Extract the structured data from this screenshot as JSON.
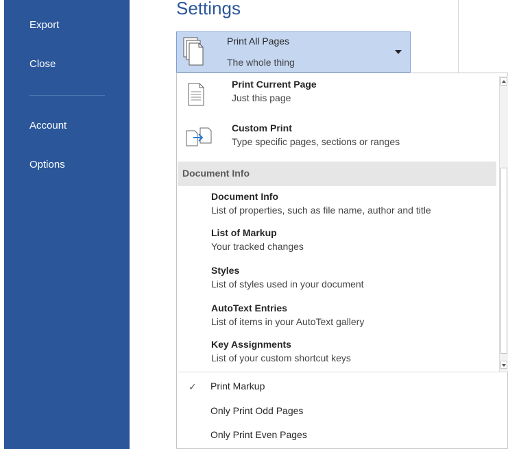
{
  "nav": {
    "items": [
      {
        "label": "Export"
      },
      {
        "label": "Close"
      },
      {
        "label": "Account"
      },
      {
        "label": "Options"
      }
    ]
  },
  "settings": {
    "title": "Settings",
    "selected": {
      "label": "Print All Pages",
      "subtitle": "The whole thing",
      "icon": "pages-icon"
    }
  },
  "dropdown": {
    "options": [
      {
        "label": "Print Current Page",
        "subtitle": "Just this page",
        "icon": "page-icon"
      },
      {
        "label": "Custom Print",
        "subtitle": "Type specific pages, sections or ranges",
        "icon": "custom-print-icon"
      }
    ],
    "section_header": "Document Info",
    "info_items": [
      {
        "label": "Document Info",
        "subtitle": "List of properties, such as file name, author and title"
      },
      {
        "label": "List of Markup",
        "subtitle": "Your tracked changes"
      },
      {
        "label": "Styles",
        "subtitle": "List of styles used in your document"
      },
      {
        "label": "AutoText Entries",
        "subtitle": "List of items in your AutoText gallery"
      },
      {
        "label": "Key Assignments",
        "subtitle": "List of your custom shortcut keys"
      }
    ],
    "toggles": [
      {
        "label": "Print Markup",
        "checked": true,
        "check_mark": "✓"
      },
      {
        "label": "Only Print Odd Pages",
        "checked": false
      },
      {
        "label": "Only Print Even Pages",
        "checked": false
      }
    ]
  },
  "colors": {
    "nav_background": "#2b579a",
    "selected_background": "#c5d6f0",
    "section_background": "#e6e6e6"
  }
}
